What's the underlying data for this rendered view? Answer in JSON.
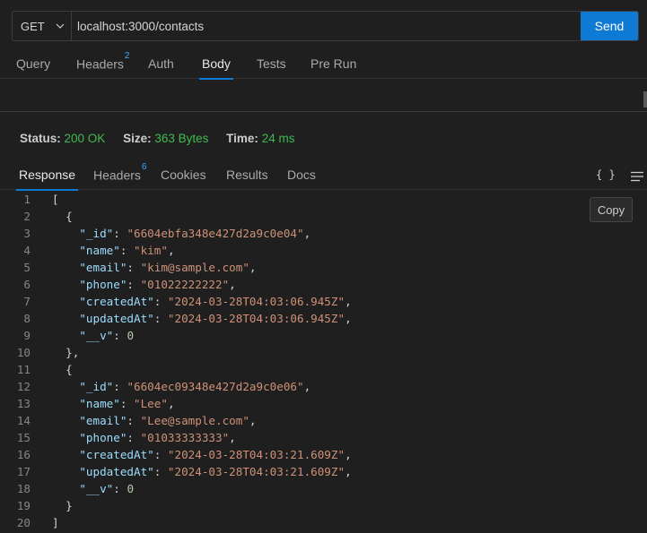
{
  "request": {
    "method": "GET",
    "url": "localhost:3000/contacts",
    "send_label": "Send"
  },
  "request_tabs": [
    {
      "label": "Query",
      "badge": ""
    },
    {
      "label": "Headers",
      "badge": "2"
    },
    {
      "label": "Auth",
      "badge": ""
    },
    {
      "label": "Body",
      "badge": "",
      "active": true
    },
    {
      "label": "Tests",
      "badge": ""
    },
    {
      "label": "Pre Run",
      "badge": ""
    }
  ],
  "status": {
    "status_label": "Status:",
    "status_value": "200 OK",
    "size_label": "Size:",
    "size_value": "363 Bytes",
    "time_label": "Time:",
    "time_value": "24 ms"
  },
  "response_tabs": [
    {
      "label": "Response",
      "badge": "",
      "active": true
    },
    {
      "label": "Headers",
      "badge": "6"
    },
    {
      "label": "Cookies",
      "badge": ""
    },
    {
      "label": "Results",
      "badge": ""
    },
    {
      "label": "Docs",
      "badge": ""
    }
  ],
  "response_toolbar": {
    "format_icon_text": "{ }",
    "copy_label": "Copy"
  },
  "colors": {
    "accent": "#0e7ad4",
    "status_ok": "#3fba50",
    "json_key": "#9cdcfe",
    "json_string": "#ce9178",
    "json_number": "#b5cea8"
  },
  "response_lines": [
    {
      "num": "1",
      "indent": "",
      "tokens": [
        {
          "t": "p",
          "v": "["
        }
      ]
    },
    {
      "num": "2",
      "indent": "  ",
      "tokens": [
        {
          "t": "p",
          "v": "{"
        }
      ]
    },
    {
      "num": "3",
      "indent": "    ",
      "tokens": [
        {
          "t": "k",
          "v": "\"_id\""
        },
        {
          "t": "p",
          "v": ": "
        },
        {
          "t": "s",
          "v": "\"6604ebfa348e427d2a9c0e04\""
        },
        {
          "t": "p",
          "v": ","
        }
      ]
    },
    {
      "num": "4",
      "indent": "    ",
      "tokens": [
        {
          "t": "k",
          "v": "\"name\""
        },
        {
          "t": "p",
          "v": ": "
        },
        {
          "t": "s",
          "v": "\"kim\""
        },
        {
          "t": "p",
          "v": ","
        }
      ]
    },
    {
      "num": "5",
      "indent": "    ",
      "tokens": [
        {
          "t": "k",
          "v": "\"email\""
        },
        {
          "t": "p",
          "v": ": "
        },
        {
          "t": "s",
          "v": "\"kim@sample.com\""
        },
        {
          "t": "p",
          "v": ","
        }
      ]
    },
    {
      "num": "6",
      "indent": "    ",
      "tokens": [
        {
          "t": "k",
          "v": "\"phone\""
        },
        {
          "t": "p",
          "v": ": "
        },
        {
          "t": "s",
          "v": "\"01022222222\""
        },
        {
          "t": "p",
          "v": ","
        }
      ]
    },
    {
      "num": "7",
      "indent": "    ",
      "tokens": [
        {
          "t": "k",
          "v": "\"createdAt\""
        },
        {
          "t": "p",
          "v": ": "
        },
        {
          "t": "s",
          "v": "\"2024-03-28T04:03:06.945Z\""
        },
        {
          "t": "p",
          "v": ","
        }
      ]
    },
    {
      "num": "8",
      "indent": "    ",
      "tokens": [
        {
          "t": "k",
          "v": "\"updatedAt\""
        },
        {
          "t": "p",
          "v": ": "
        },
        {
          "t": "s",
          "v": "\"2024-03-28T04:03:06.945Z\""
        },
        {
          "t": "p",
          "v": ","
        }
      ]
    },
    {
      "num": "9",
      "indent": "    ",
      "tokens": [
        {
          "t": "k",
          "v": "\"__v\""
        },
        {
          "t": "p",
          "v": ": "
        },
        {
          "t": "n",
          "v": "0"
        }
      ]
    },
    {
      "num": "10",
      "indent": "  ",
      "tokens": [
        {
          "t": "p",
          "v": "},"
        }
      ]
    },
    {
      "num": "11",
      "indent": "  ",
      "tokens": [
        {
          "t": "p",
          "v": "{"
        }
      ]
    },
    {
      "num": "12",
      "indent": "    ",
      "tokens": [
        {
          "t": "k",
          "v": "\"_id\""
        },
        {
          "t": "p",
          "v": ": "
        },
        {
          "t": "s",
          "v": "\"6604ec09348e427d2a9c0e06\""
        },
        {
          "t": "p",
          "v": ","
        }
      ]
    },
    {
      "num": "13",
      "indent": "    ",
      "tokens": [
        {
          "t": "k",
          "v": "\"name\""
        },
        {
          "t": "p",
          "v": ": "
        },
        {
          "t": "s",
          "v": "\"Lee\""
        },
        {
          "t": "p",
          "v": ","
        }
      ]
    },
    {
      "num": "14",
      "indent": "    ",
      "tokens": [
        {
          "t": "k",
          "v": "\"email\""
        },
        {
          "t": "p",
          "v": ": "
        },
        {
          "t": "s",
          "v": "\"Lee@sample.com\""
        },
        {
          "t": "p",
          "v": ","
        }
      ]
    },
    {
      "num": "15",
      "indent": "    ",
      "tokens": [
        {
          "t": "k",
          "v": "\"phone\""
        },
        {
          "t": "p",
          "v": ": "
        },
        {
          "t": "s",
          "v": "\"01033333333\""
        },
        {
          "t": "p",
          "v": ","
        }
      ]
    },
    {
      "num": "16",
      "indent": "    ",
      "tokens": [
        {
          "t": "k",
          "v": "\"createdAt\""
        },
        {
          "t": "p",
          "v": ": "
        },
        {
          "t": "s",
          "v": "\"2024-03-28T04:03:21.609Z\""
        },
        {
          "t": "p",
          "v": ","
        }
      ]
    },
    {
      "num": "17",
      "indent": "    ",
      "tokens": [
        {
          "t": "k",
          "v": "\"updatedAt\""
        },
        {
          "t": "p",
          "v": ": "
        },
        {
          "t": "s",
          "v": "\"2024-03-28T04:03:21.609Z\""
        },
        {
          "t": "p",
          "v": ","
        }
      ]
    },
    {
      "num": "18",
      "indent": "    ",
      "tokens": [
        {
          "t": "k",
          "v": "\"__v\""
        },
        {
          "t": "p",
          "v": ": "
        },
        {
          "t": "n",
          "v": "0"
        }
      ]
    },
    {
      "num": "19",
      "indent": "  ",
      "tokens": [
        {
          "t": "p",
          "v": "}"
        }
      ]
    },
    {
      "num": "20",
      "indent": "",
      "tokens": [
        {
          "t": "p",
          "v": "]"
        }
      ]
    }
  ]
}
